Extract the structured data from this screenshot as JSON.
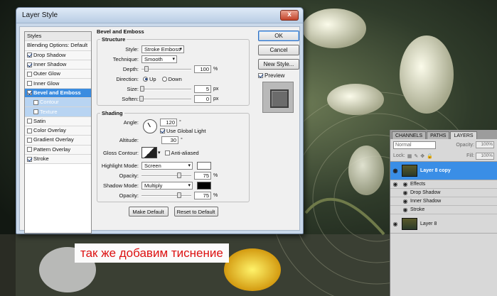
{
  "dialog": {
    "title": "Layer Style",
    "close_label": "x",
    "styles_header": "Styles",
    "styles_items": [
      {
        "label": "Blending Options: Default",
        "checkbox": false,
        "checked": false,
        "selected": false,
        "sub": false
      },
      {
        "label": "Drop Shadow",
        "checkbox": true,
        "checked": true,
        "selected": false,
        "sub": false
      },
      {
        "label": "Inner Shadow",
        "checkbox": true,
        "checked": true,
        "selected": false,
        "sub": false
      },
      {
        "label": "Outer Glow",
        "checkbox": true,
        "checked": false,
        "selected": false,
        "sub": false
      },
      {
        "label": "Inner Glow",
        "checkbox": true,
        "checked": false,
        "selected": false,
        "sub": false
      },
      {
        "label": "Bevel and Emboss",
        "checkbox": true,
        "checked": true,
        "selected": true,
        "sub": false
      },
      {
        "label": "Contour",
        "checkbox": true,
        "checked": false,
        "selected": false,
        "sub": true
      },
      {
        "label": "Texture",
        "checkbox": true,
        "checked": false,
        "selected": false,
        "sub": true
      },
      {
        "label": "Satin",
        "checkbox": true,
        "checked": false,
        "selected": false,
        "sub": false
      },
      {
        "label": "Color Overlay",
        "checkbox": true,
        "checked": false,
        "selected": false,
        "sub": false
      },
      {
        "label": "Gradient Overlay",
        "checkbox": true,
        "checked": false,
        "selected": false,
        "sub": false
      },
      {
        "label": "Pattern Overlay",
        "checkbox": true,
        "checked": false,
        "selected": false,
        "sub": false
      },
      {
        "label": "Stroke",
        "checkbox": true,
        "checked": true,
        "selected": false,
        "sub": false
      }
    ],
    "section_title": "Bevel and Emboss",
    "structure": {
      "legend": "Structure",
      "style_label": "Style:",
      "style_value": "Stroke Emboss",
      "technique_label": "Technique:",
      "technique_value": "Smooth",
      "depth_label": "Depth:",
      "depth_value": "100",
      "depth_unit": "%",
      "depth_level": 0.1,
      "direction_label": "Direction:",
      "direction_up": "Up",
      "direction_down": "Down",
      "size_label": "Size:",
      "size_value": "5",
      "size_unit": "px",
      "size_level": 0.02,
      "soften_label": "Soften:",
      "soften_value": "0",
      "soften_unit": "px",
      "soften_level": 0.0
    },
    "shading": {
      "legend": "Shading",
      "angle_label": "Angle:",
      "angle_value": "120",
      "angle_unit": "°",
      "global_light_label": "Use Global Light",
      "altitude_label": "Altitude:",
      "altitude_value": "30",
      "altitude_unit": "°",
      "gloss_label": "Gloss Contour:",
      "antialiased_label": "Anti-aliased",
      "highlight_label": "Highlight Mode:",
      "highlight_value": "Screen",
      "highlight_color": "#ffffff",
      "hl_opacity_label": "Opacity:",
      "hl_opacity_value": "75",
      "hl_opacity_unit": "%",
      "hl_opacity_level": 0.75,
      "shadow_label": "Shadow Mode:",
      "shadow_value": "Multiply",
      "shadow_color": "#000000",
      "sh_opacity_label": "Opacity:",
      "sh_opacity_value": "75",
      "sh_opacity_unit": "%",
      "sh_opacity_level": 0.75
    },
    "make_default": "Make Default",
    "reset_default": "Reset to Default",
    "ok": "OK",
    "cancel": "Cancel",
    "new_style": "New Style...",
    "preview_label": "Preview"
  },
  "layers_panel": {
    "tabs": [
      "CHANNELS",
      "PATHS",
      "LAYERS"
    ],
    "blend_mode": "Normal",
    "opacity_label": "Opacity:",
    "opacity_value": "100%",
    "lock_label": "Lock:",
    "fill_label": "Fill:",
    "fill_value": "100%",
    "layers": [
      {
        "name": "Layer 8 copy",
        "selected": true
      },
      {
        "name": "Layer 8",
        "selected": false
      }
    ],
    "effects_label": "Effects",
    "effects": [
      "Drop Shadow",
      "Inner Shadow",
      "Stroke"
    ]
  },
  "annotation": {
    "text": "так же добавим тиснение",
    "color": "#dd1111"
  }
}
